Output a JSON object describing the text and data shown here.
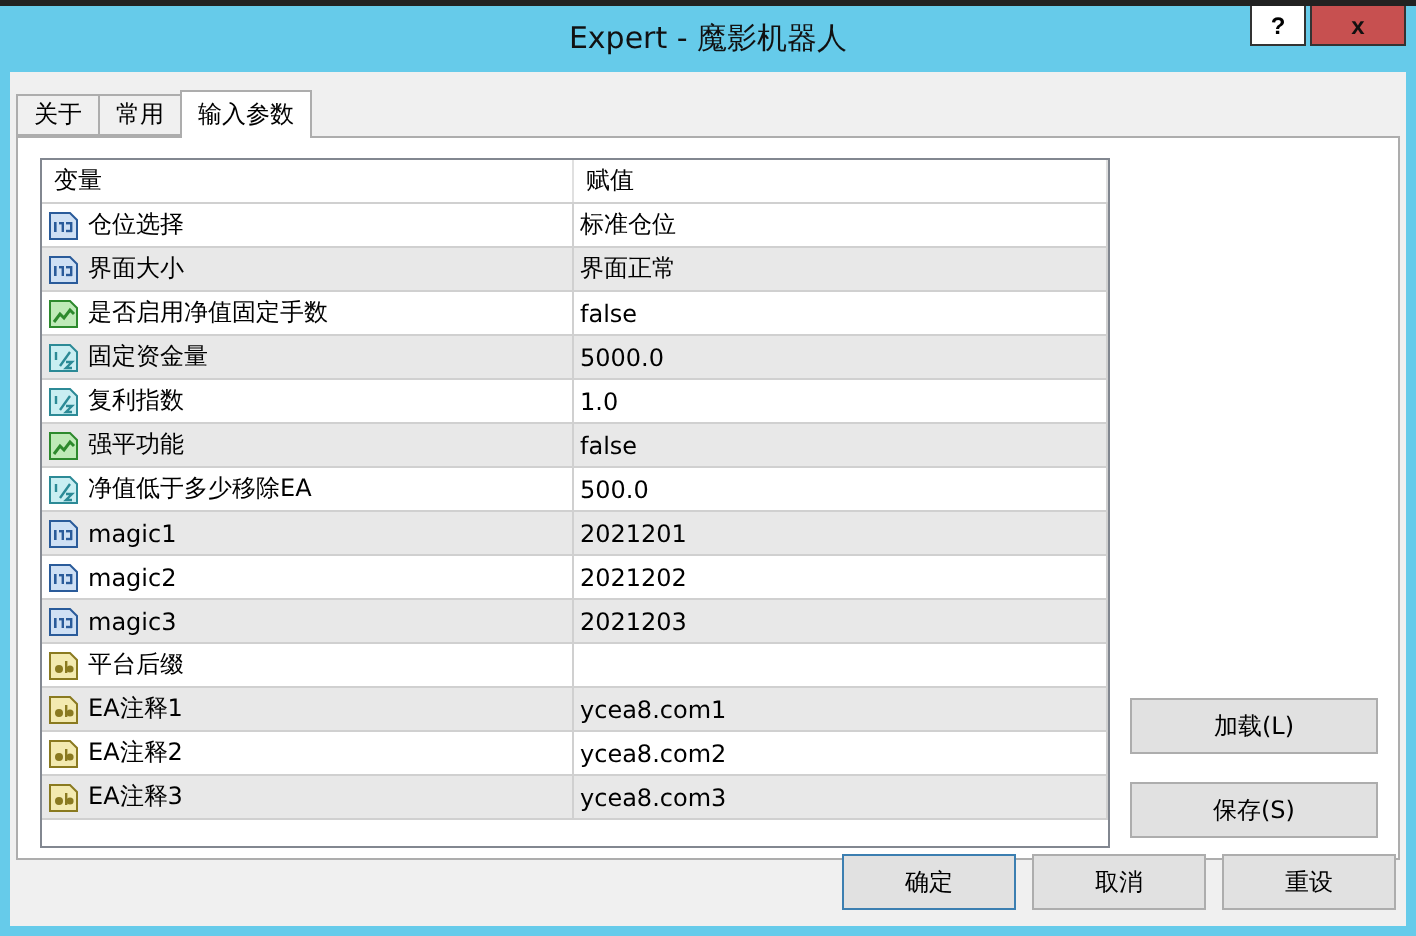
{
  "window": {
    "title": "Expert - 魔影机器人",
    "help_button": "?",
    "close_button": "x"
  },
  "tabs": [
    {
      "label": "关于",
      "selected": false
    },
    {
      "label": "常用",
      "selected": false
    },
    {
      "label": "输入参数",
      "selected": true
    }
  ],
  "table": {
    "columns": [
      "变量",
      "赋值"
    ],
    "rows": [
      {
        "kind": "int",
        "name": "仓位选择",
        "value": "标准仓位"
      },
      {
        "kind": "int",
        "name": "界面大小",
        "value": "界面正常"
      },
      {
        "kind": "bool",
        "name": "是否启用净值固定手数",
        "value": "false"
      },
      {
        "kind": "double",
        "name": "固定资金量",
        "value": "5000.0"
      },
      {
        "kind": "double",
        "name": "复利指数",
        "value": "1.0"
      },
      {
        "kind": "bool",
        "name": "强平功能",
        "value": "false"
      },
      {
        "kind": "double",
        "name": "净值低于多少移除EA",
        "value": "500.0"
      },
      {
        "kind": "int",
        "name": "magic1",
        "value": "2021201"
      },
      {
        "kind": "int",
        "name": "magic2",
        "value": "2021202"
      },
      {
        "kind": "int",
        "name": "magic3",
        "value": "2021203"
      },
      {
        "kind": "string",
        "name": "平台后缀"
      },
      {
        "kind": "string",
        "name": "EA注释1",
        "value": "ycea8.com1"
      },
      {
        "kind": "string",
        "name": "EA注释2",
        "value": "ycea8.com2"
      },
      {
        "kind": "string",
        "name": "EA注释3",
        "value": "ycea8.com3"
      }
    ]
  },
  "side_buttons": [
    "加载(L)",
    "保存(S)"
  ],
  "footer_buttons": [
    {
      "label": "确定",
      "default": true
    },
    {
      "label": "取消",
      "default": false
    },
    {
      "label": "重设",
      "default": false
    }
  ]
}
